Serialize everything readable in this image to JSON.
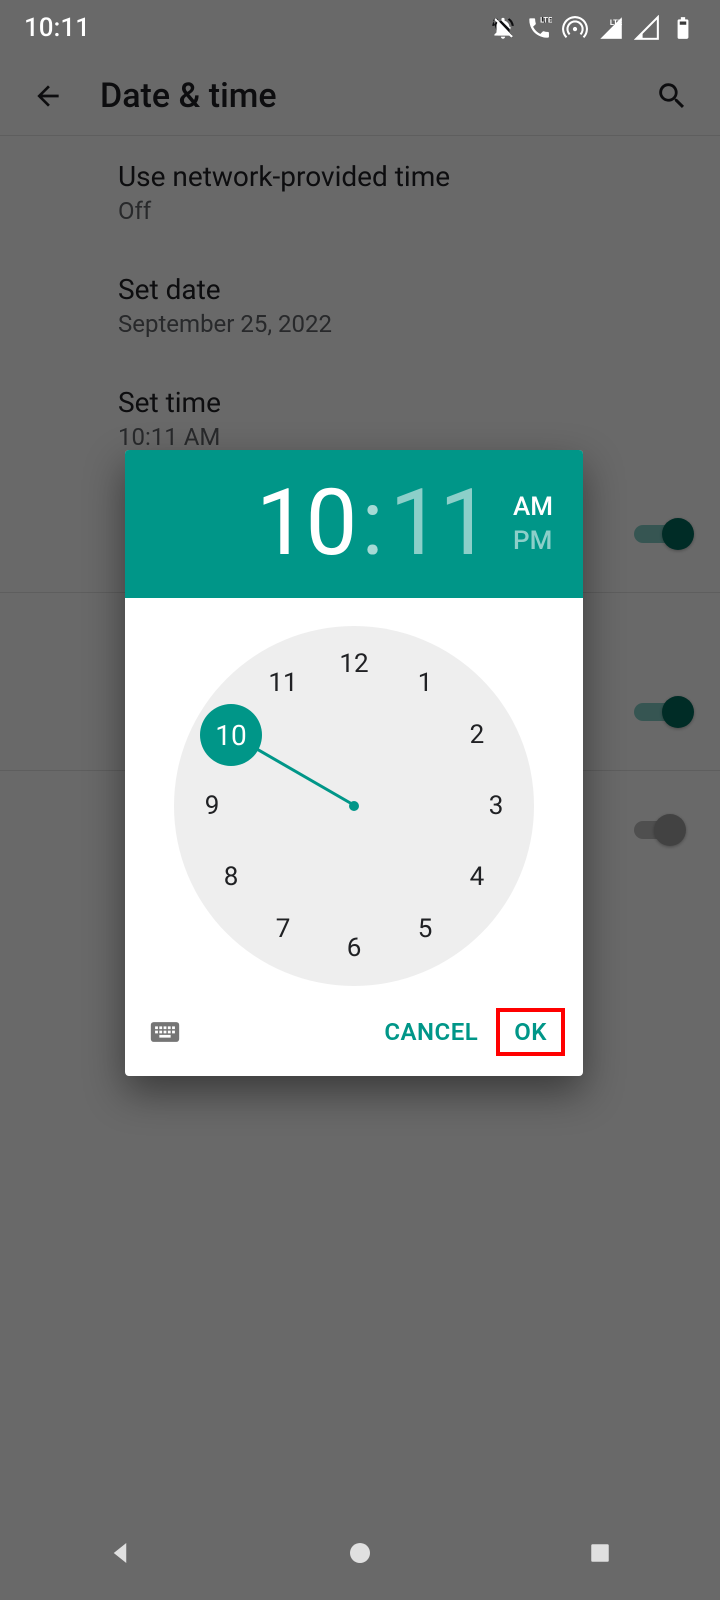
{
  "status": {
    "time": "10:11",
    "lte": "LTE"
  },
  "appbar": {
    "title": "Date & time"
  },
  "settings": {
    "net_time": {
      "title": "Use network-provided time",
      "value": "Off"
    },
    "set_date": {
      "title": "Set date",
      "value": "September 25, 2022"
    },
    "set_time": {
      "title": "Set time",
      "value": "10:11 AM"
    }
  },
  "dialog": {
    "hour": "10",
    "minute": "11",
    "am": "AM",
    "pm": "PM",
    "ampm_selected": "AM",
    "selected_hour": 10,
    "cancel": "CANCEL",
    "ok": "OK",
    "clock_numbers": [
      "12",
      "1",
      "2",
      "3",
      "4",
      "5",
      "6",
      "7",
      "8",
      "9",
      "10",
      "11"
    ]
  }
}
